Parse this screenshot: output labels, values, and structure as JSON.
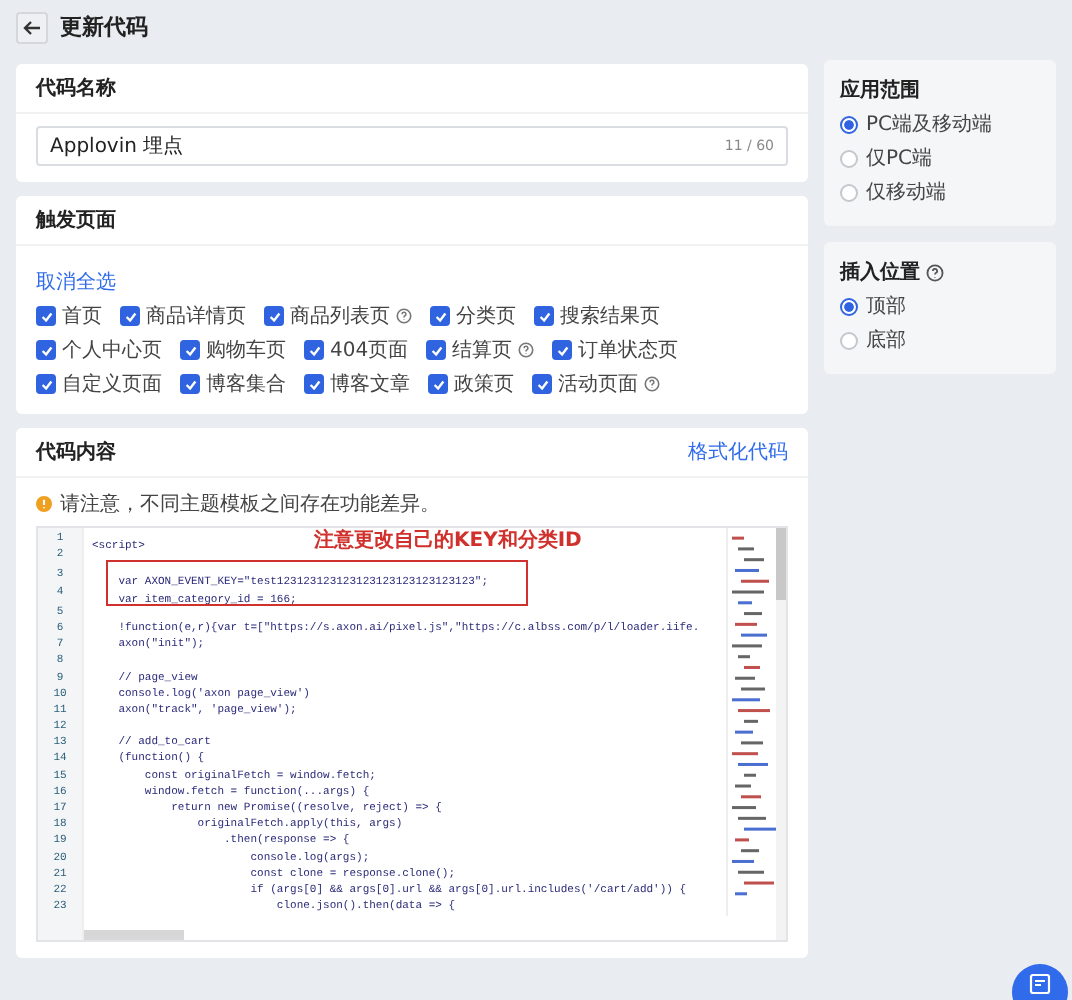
{
  "header": {
    "title": "更新代码"
  },
  "code_name": {
    "title": "代码名称",
    "value": "Applovin 埋点",
    "counter": "11 / 60"
  },
  "trigger_pages": {
    "title": "触发页面",
    "deselect_all": "取消全选",
    "items": [
      {
        "label": "首页",
        "checked": true,
        "help": false
      },
      {
        "label": "商品详情页",
        "checked": true,
        "help": false
      },
      {
        "label": "商品列表页",
        "checked": true,
        "help": true
      },
      {
        "label": "分类页",
        "checked": true,
        "help": false
      },
      {
        "label": "搜索结果页",
        "checked": true,
        "help": false
      },
      {
        "label": "个人中心页",
        "checked": true,
        "help": false
      },
      {
        "label": "购物车页",
        "checked": true,
        "help": false
      },
      {
        "label": "404页面",
        "checked": true,
        "help": false
      },
      {
        "label": "结算页",
        "checked": true,
        "help": true
      },
      {
        "label": "订单状态页",
        "checked": true,
        "help": false
      },
      {
        "label": "自定义页面",
        "checked": true,
        "help": false
      },
      {
        "label": "博客集合",
        "checked": true,
        "help": false
      },
      {
        "label": "博客文章",
        "checked": true,
        "help": false
      },
      {
        "label": "政策页",
        "checked": true,
        "help": false
      },
      {
        "label": "活动页面",
        "checked": true,
        "help": true
      }
    ]
  },
  "code_content": {
    "title": "代码内容",
    "format_link": "格式化代码",
    "notice": "请注意，不同主题模板之间存在功能差异。",
    "note": "注意更改自己的KEY和分类ID",
    "lines": [
      {
        "number": "1",
        "text": "<script>",
        "highlighted": false
      },
      {
        "number": "2",
        "highlighted": false
      },
      {
        "number": "3",
        "text": "    var AXON_EVENT_KEY=\"test123123123123123123123123123123\";",
        "highlighted": true
      },
      {
        "number": "4",
        "text": "    var item_category_id = 166;",
        "highlighted": true
      },
      {
        "number": "5",
        "highlighted": false
      },
      {
        "number": "6",
        "text": "    !function(e,r){var t=[\"https://s.axon.ai/pixel.js\",\"https://c.albss.com/p/l/loader.iife.",
        "highlighted": false
      },
      {
        "number": "7",
        "text": "    axon(\"init\");",
        "highlighted": false
      },
      {
        "number": "8",
        "highlighted": false
      },
      {
        "number": "9",
        "text": "    // page_view",
        "highlighted": false
      },
      {
        "number": "10",
        "text": "    console.log('axon page_view')",
        "highlighted": false
      },
      {
        "number": "11",
        "text": "    axon(\"track\", 'page_view');",
        "highlighted": false
      },
      {
        "number": "12",
        "highlighted": false
      },
      {
        "number": "13",
        "text": "    // add_to_cart",
        "highlighted": false
      },
      {
        "number": "14",
        "text": "    (function() {",
        "highlighted": false
      },
      {
        "number": "15",
        "text": "        const originalFetch = window.fetch;",
        "highlighted": false
      },
      {
        "number": "16",
        "text": "        window.fetch = function(...args) {",
        "highlighted": false
      },
      {
        "number": "17",
        "text": "            return new Promise((resolve, reject) => {",
        "highlighted": false
      },
      {
        "number": "18",
        "text": "                originalFetch.apply(this, args)",
        "highlighted": false
      },
      {
        "number": "19",
        "text": "                    .then(response => {",
        "highlighted": false
      },
      {
        "number": "20",
        "text": "                        console.log(args);",
        "highlighted": false
      },
      {
        "number": "21",
        "text": "                        const clone = response.clone();",
        "highlighted": false
      },
      {
        "number": "22",
        "text": "                        if (args[0] && args[0].url && args[0].url.includes('/cart/add')) {",
        "highlighted": false
      },
      {
        "number": "23",
        "text": "                            clone.json().then(data => {",
        "highlighted": false
      }
    ]
  },
  "scope": {
    "title": "应用范围",
    "options": [
      {
        "label": "PC端及移动端",
        "selected": true
      },
      {
        "label": "仅PC端",
        "selected": false
      },
      {
        "label": "仅移动端",
        "selected": false
      }
    ]
  },
  "position": {
    "title": "插入位置",
    "help": true,
    "options": [
      {
        "label": "顶部",
        "selected": true
      },
      {
        "label": "底部",
        "selected": false
      }
    ]
  }
}
